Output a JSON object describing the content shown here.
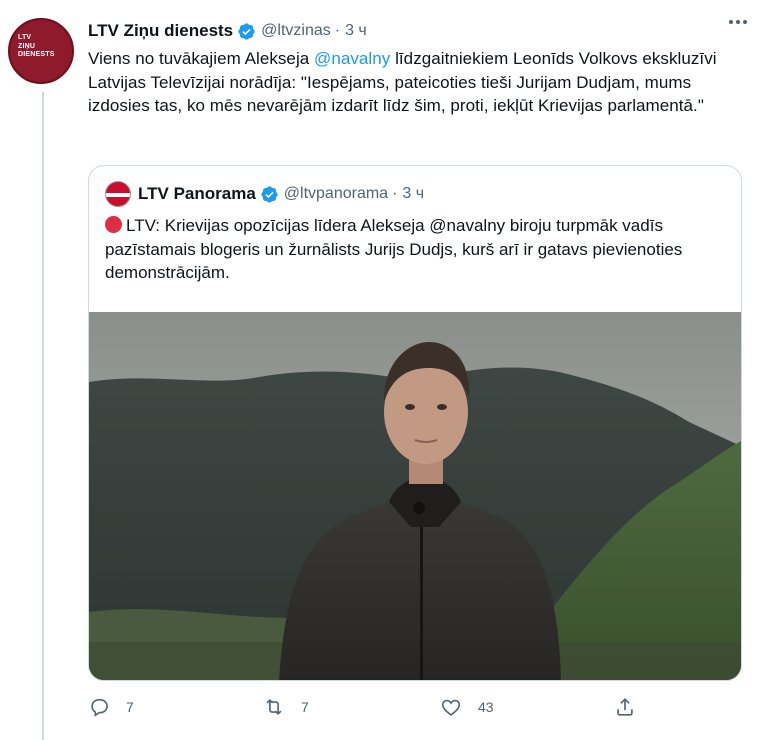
{
  "tweet": {
    "author_name": "LTV Ziņu dienests",
    "author_handle": "@ltvzinas",
    "separator": "·",
    "time": "3 ч",
    "avatar_text": [
      "LTV",
      "ZIŅU",
      "DIENESTS"
    ],
    "text_part1": "Viens no tuvākajiem Alekseja ",
    "mention": "@navalny",
    "text_part2": " līdzgaitniekiem Leonīds Volkovs ekskluzīvi Latvijas Televīzijai norādīja: \"Iespējams, pateicoties tieši Jurijam Dudjam, mums izdosies tas, ko mēs nevarējām izdarīt līdz šim, proti, iekļūt Krievijas parlamentā.\""
  },
  "quoted": {
    "author_name": "LTV Panorama",
    "author_handle": "@ltvpanorama",
    "separator": "·",
    "time": "3 ч",
    "text": "LTV: Krievijas opozīcijas līdera Alekseja @navalny biroju turpmāk vadīs pazīstamais blogeris un žurnālists Jurijs Dudjs, kurš arī ir gatavs pievienoties demonstrācijām."
  },
  "actions": {
    "reply_count": "7",
    "retweet_count": "7",
    "like_count": "43",
    "share_count": ""
  },
  "colors": {
    "accent": "#1d9bf0",
    "text": "#0f1419",
    "secondary": "#536471",
    "border": "#cfd9de",
    "red_circle": "#dd2e44"
  },
  "icons": [
    "verified-badge-icon",
    "more-icon",
    "reply-icon",
    "retweet-icon",
    "like-icon",
    "share-icon",
    "red-circle-emoji"
  ]
}
